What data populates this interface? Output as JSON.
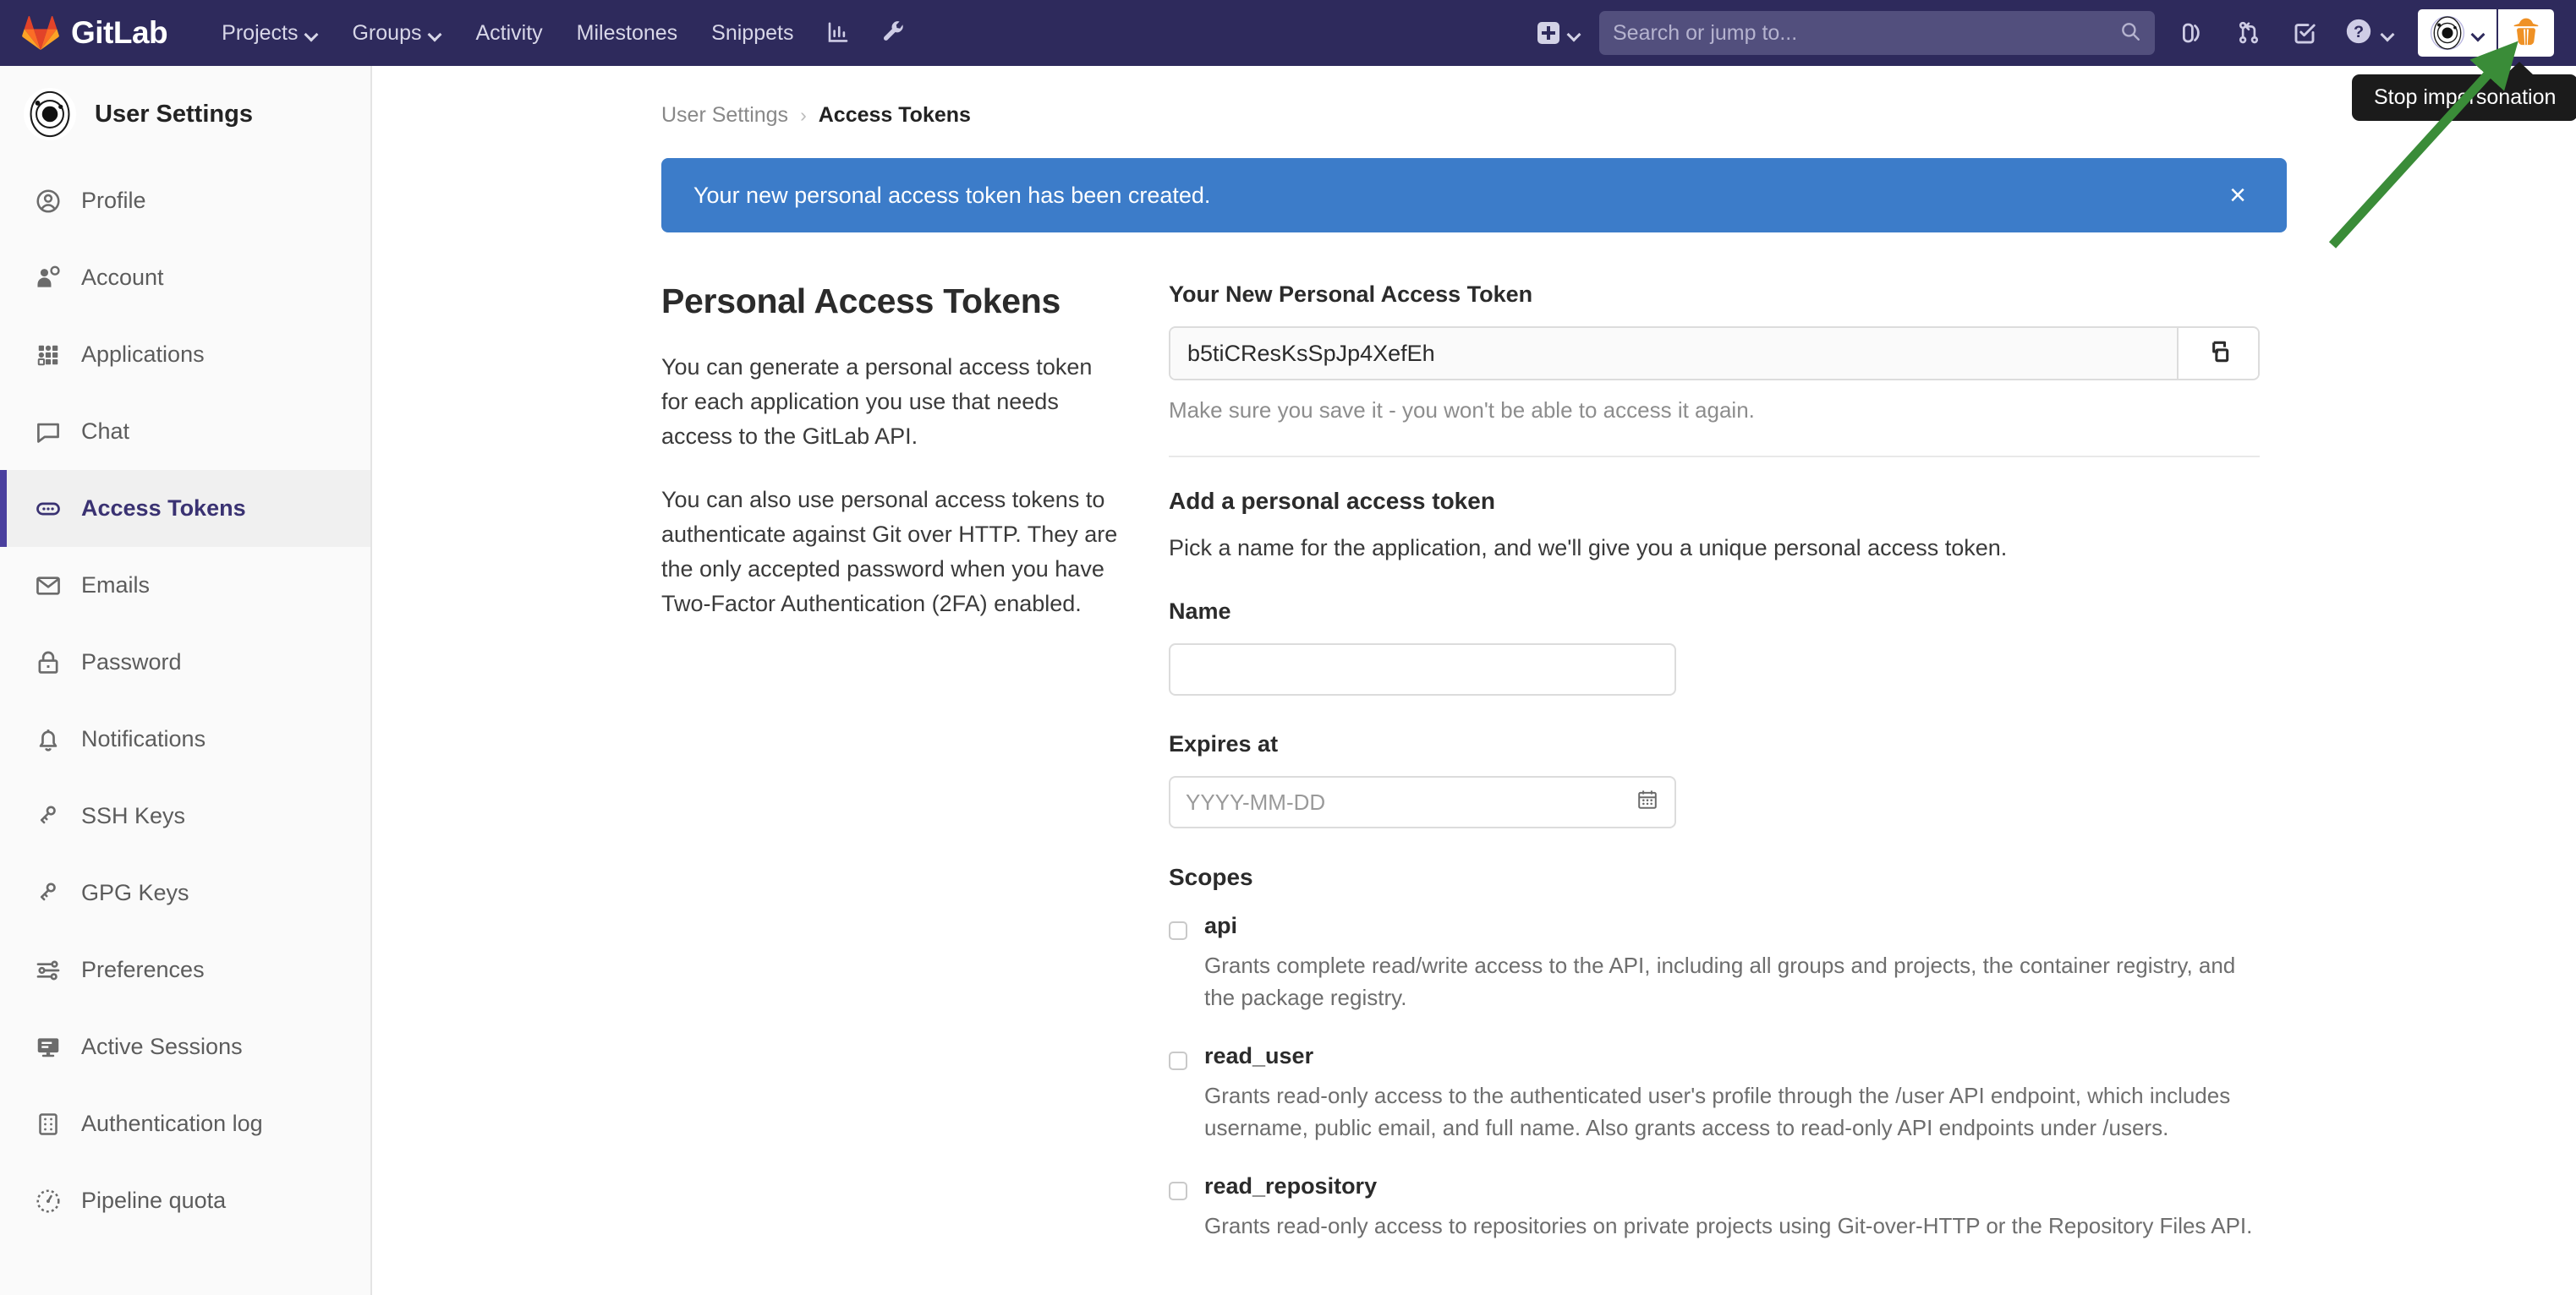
{
  "topnav": {
    "brand": "GitLab",
    "links": [
      {
        "label": "Projects",
        "caret": true
      },
      {
        "label": "Groups",
        "caret": true
      },
      {
        "label": "Activity",
        "caret": false
      },
      {
        "label": "Milestones",
        "caret": false
      },
      {
        "label": "Snippets",
        "caret": false
      }
    ],
    "icon_buttons": [
      "analytics-icon",
      "wrench-icon"
    ],
    "new_dropdown_label": "plus-icon",
    "search": {
      "placeholder": "Search or jump to...",
      "value": "",
      "icon": "search-icon"
    },
    "right_icons": [
      "issues-icon",
      "merge-requests-icon",
      "todos-icon",
      "help-icon"
    ],
    "avatar_icon": "user-avatar",
    "impersonation_icon": "spy-icon"
  },
  "tooltip": {
    "text": "Stop impersonation"
  },
  "sidebar": {
    "header": {
      "title": "User Settings",
      "avatar": "user-avatar"
    },
    "items": [
      {
        "label": "Profile",
        "icon": "profile-icon",
        "active": false
      },
      {
        "label": "Account",
        "icon": "account-icon",
        "active": false
      },
      {
        "label": "Applications",
        "icon": "applications-icon",
        "active": false
      },
      {
        "label": "Chat",
        "icon": "chat-icon",
        "active": false
      },
      {
        "label": "Access Tokens",
        "icon": "token-icon",
        "active": true
      },
      {
        "label": "Emails",
        "icon": "email-icon",
        "active": false
      },
      {
        "label": "Password",
        "icon": "lock-icon",
        "active": false
      },
      {
        "label": "Notifications",
        "icon": "bell-icon",
        "active": false
      },
      {
        "label": "SSH Keys",
        "icon": "key-icon",
        "active": false
      },
      {
        "label": "GPG Keys",
        "icon": "key-icon",
        "active": false
      },
      {
        "label": "Preferences",
        "icon": "sliders-icon",
        "active": false
      },
      {
        "label": "Active Sessions",
        "icon": "monitor-icon",
        "active": false
      },
      {
        "label": "Authentication log",
        "icon": "log-icon",
        "active": false
      },
      {
        "label": "Pipeline quota",
        "icon": "gauge-icon",
        "active": false
      }
    ]
  },
  "breadcrumb": {
    "parent": "User Settings",
    "separator": "›",
    "current": "Access Tokens"
  },
  "alert": {
    "message": "Your new personal access token has been created.",
    "close_label": "×",
    "color": "#3c7cc9"
  },
  "intro": {
    "heading": "Personal Access Tokens",
    "paragraph1": "You can generate a personal access token for each application you use that needs access to the GitLab API.",
    "paragraph2": "You can also use personal access tokens to authenticate against Git over HTTP. They are the only accepted password when you have Two-Factor Authentication (2FA) enabled."
  },
  "new_token": {
    "label": "Your New Personal Access Token",
    "value": "b5tiCResKsSpJp4XefEh",
    "copy_icon": "copy-icon",
    "helper": "Make sure you save it - you won't be able to access it again."
  },
  "add_form": {
    "title": "Add a personal access token",
    "description": "Pick a name for the application, and we'll give you a unique personal access token.",
    "name_label": "Name",
    "name_value": "",
    "name_placeholder": "",
    "expires_label": "Expires at",
    "expires_value": "",
    "expires_placeholder": "YYYY-MM-DD",
    "calendar_icon": "calendar-icon"
  },
  "scopes": {
    "title": "Scopes",
    "items": [
      {
        "name": "api",
        "checked": false,
        "description": "Grants complete read/write access to the API, including all groups and projects, the container registry, and the package registry."
      },
      {
        "name": "read_user",
        "checked": false,
        "description": "Grants read-only access to the authenticated user's profile through the /user API endpoint, which includes username, public email, and full name. Also grants access to read-only API endpoints under /users."
      },
      {
        "name": "read_repository",
        "checked": false,
        "description": "Grants read-only access to repositories on private projects using Git-over-HTTP or the Repository Files API."
      }
    ]
  },
  "annotation": {
    "arrow_color": "#3a8c38"
  }
}
